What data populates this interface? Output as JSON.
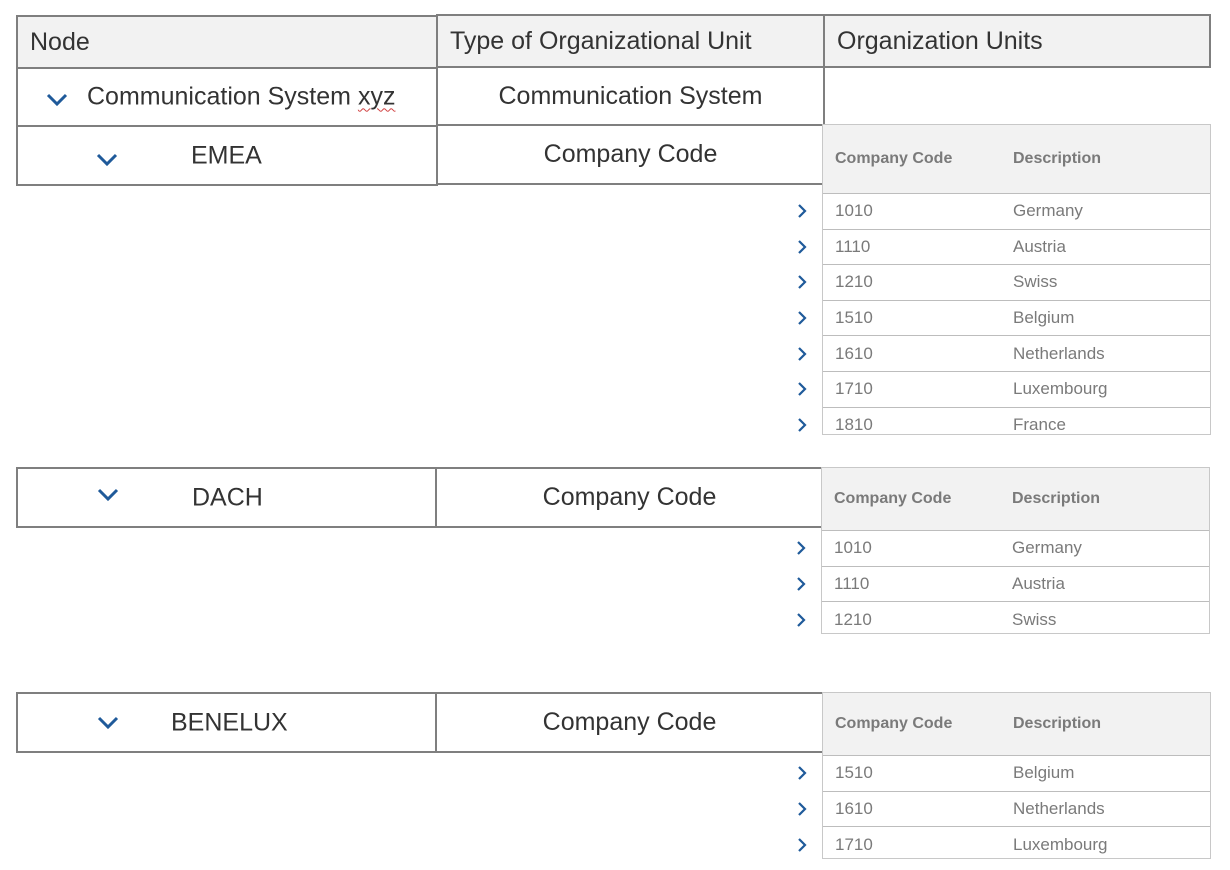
{
  "header": {
    "node": "Node",
    "type": "Type of Organizational Unit",
    "org_units": "Organization Units"
  },
  "root_row": {
    "node_label": "Communication System",
    "node_label_suffix": "xyz",
    "type": "Communication System",
    "expanded": true
  },
  "subtable_headers": {
    "code": "Company Code",
    "description": "Description"
  },
  "groups": [
    {
      "node_label": "EMEA",
      "type": "Company Code",
      "expanded": true,
      "rows": [
        {
          "code": "1010",
          "description": "Germany"
        },
        {
          "code": "1110",
          "description": "Austria"
        },
        {
          "code": "1210",
          "description": "Swiss"
        },
        {
          "code": "1510",
          "description": "Belgium"
        },
        {
          "code": "1610",
          "description": "Netherlands"
        },
        {
          "code": "1710",
          "description": "Luxembourg"
        },
        {
          "code": "1810",
          "description": "France"
        }
      ]
    },
    {
      "node_label": "DACH",
      "type": "Company Code",
      "expanded": true,
      "rows": [
        {
          "code": "1010",
          "description": "Germany"
        },
        {
          "code": "1110",
          "description": "Austria"
        },
        {
          "code": "1210",
          "description": "Swiss"
        }
      ]
    },
    {
      "node_label": "BENELUX",
      "type": "Company Code",
      "expanded": true,
      "rows": [
        {
          "code": "1510",
          "description": "Belgium"
        },
        {
          "code": "1610",
          "description": "Netherlands"
        },
        {
          "code": "1710",
          "description": "Luxembourg"
        }
      ]
    }
  ],
  "colors": {
    "accent": "#1f5a9a",
    "header_bg": "#f2f2f2",
    "border": "#7f7f7f",
    "subtable_text": "#7a7a7a"
  }
}
